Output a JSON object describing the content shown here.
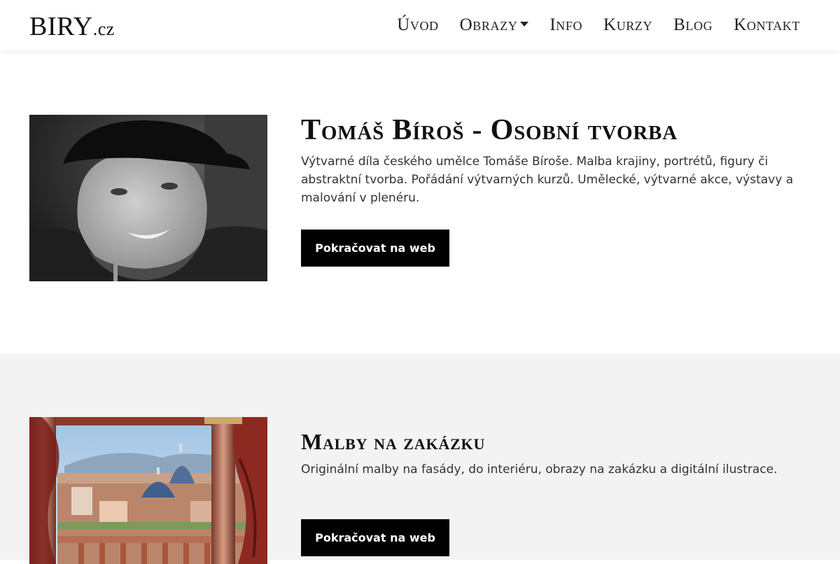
{
  "header": {
    "logo": {
      "main": "BIRY",
      "tld": ".cz"
    },
    "nav": [
      {
        "label": "Úvod"
      },
      {
        "label": "Obrazy",
        "dropdown": true
      },
      {
        "label": "Info"
      },
      {
        "label": "Kurzy"
      },
      {
        "label": "Blog"
      },
      {
        "label": "Kontakt"
      }
    ]
  },
  "sections": [
    {
      "title": "Tomáš Bíroš - Osobní tvorba",
      "description": "Výtvarné díla českého umělce Tomáše Bíroše. Malba krajiny, portrétů, figury či abstraktní tvorba. Pořádání výtvarných kurzů. Umělecké, výtvarné akce, výstavy a malování v plenéru.",
      "button": "Pokračovat na web",
      "image": "portrait-photo"
    },
    {
      "title": "Malby na zakázku",
      "description": "Originální malby na fasády, do interiéru, obrazy na zakázku a digitální ilustrace.",
      "button": "Pokračovat na web",
      "image": "city-painting"
    }
  ],
  "colors": {
    "button_bg": "#000000",
    "button_text": "#ffffff",
    "section_alt_bg": "#f3f3f3"
  }
}
